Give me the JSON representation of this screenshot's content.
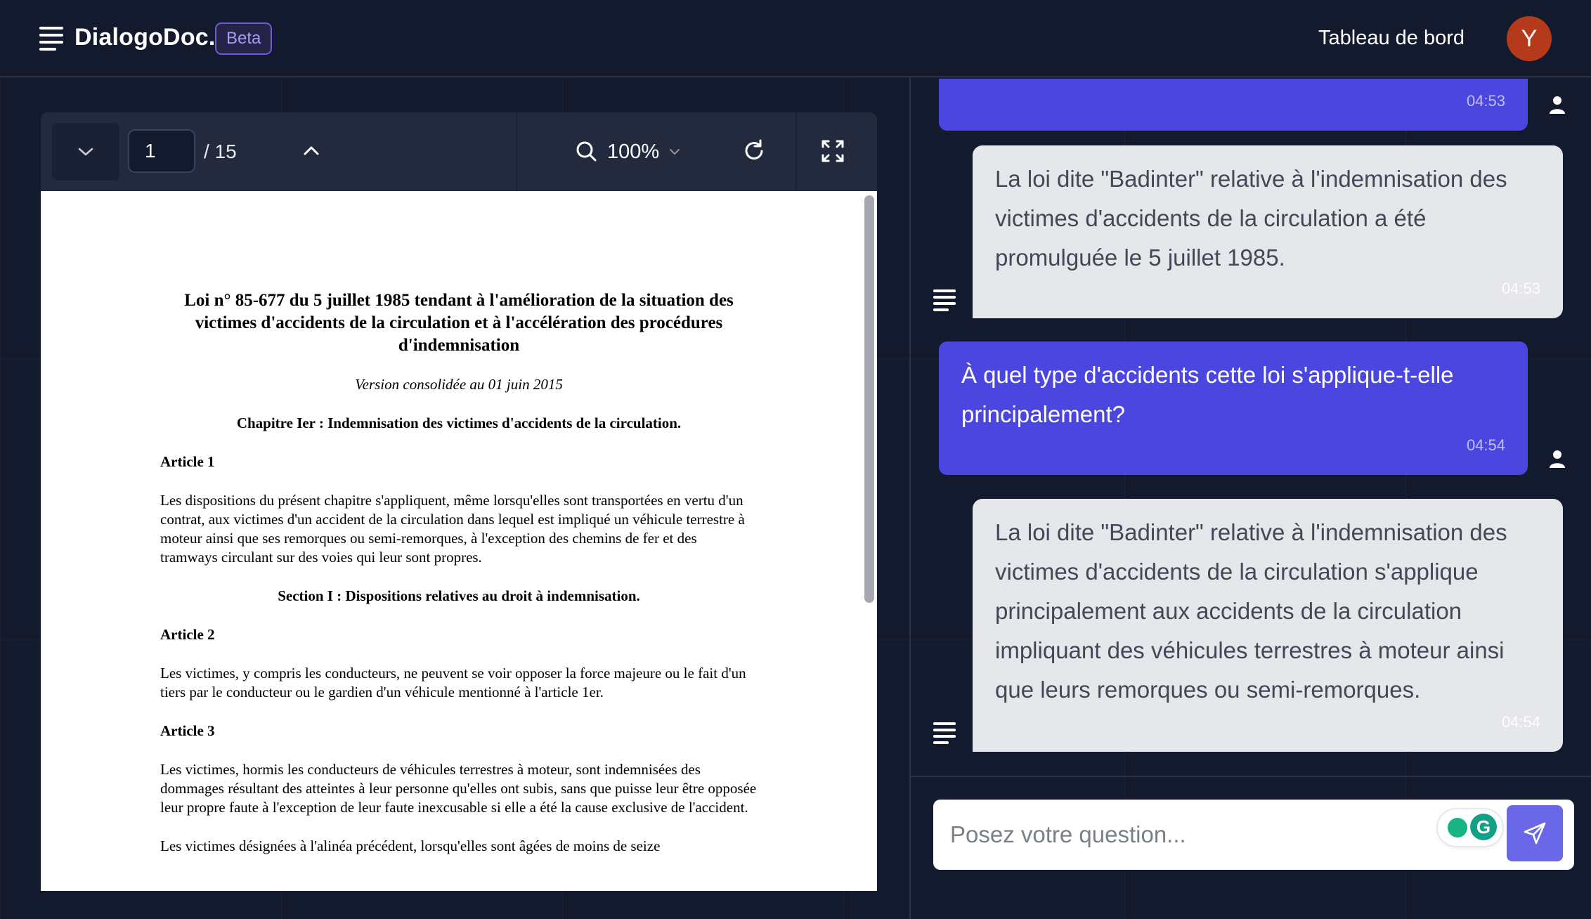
{
  "header": {
    "brand": "DialogoDoc.",
    "badge": "Beta",
    "nav_link": "Tableau de bord",
    "avatar_initial": "Y",
    "avatar_color": "#b53a1c"
  },
  "pdf_toolbar": {
    "current_page": "1",
    "total_pages": "/ 15",
    "zoom": "100%",
    "icons": [
      "chevron-down-icon",
      "chevron-up-icon",
      "search-icon",
      "refresh-icon",
      "fullscreen-icon"
    ]
  },
  "document": {
    "title": "Loi n° 85-677 du 5 juillet 1985 tendant à l'amélioration de la situation des victimes d'accidents de la circulation et à l'accélération des procédures d'indemnisation",
    "version": "Version consolidée au 01 juin 2015",
    "chapter": "Chapitre Ier : Indemnisation des victimes d'accidents de la circulation.",
    "article1_heading": "Article 1",
    "article1_text": "Les dispositions du présent chapitre s'appliquent, même lorsqu'elles sont transportées en vertu d'un contrat, aux victimes d'un accident de la circulation dans lequel est impliqué un véhicule terrestre à moteur ainsi que ses remorques ou semi-remorques, à l'exception des chemins de fer et des tramways circulant sur des voies qui leur sont propres.",
    "section1": "Section I : Dispositions relatives au droit à indemnisation.",
    "article2_heading": "Article 2",
    "article2_text": "Les victimes, y compris les conducteurs, ne peuvent se voir opposer la force majeure ou le fait d'un tiers par le conducteur ou le gardien d'un véhicule mentionné à l'article 1er.",
    "article3_heading": "Article 3",
    "article3_text": "Les victimes, hormis les conducteurs de véhicules terrestres à moteur, sont indemnisées des dommages résultant des atteintes à leur personne qu'elles ont subis, sans que puisse leur être opposée leur propre faute à l'exception de leur faute inexcusable si elle a été la cause exclusive de l'accident.",
    "article3_text2": "Les victimes désignées à l'alinéa précédent, lorsqu'elles sont âgées de moins de seize"
  },
  "chat": {
    "messages": [
      {
        "role": "user",
        "text": "",
        "time": "04:53"
      },
      {
        "role": "assistant",
        "text": "La loi dite \"Badinter\" relative à l'indemnisation des victimes d'accidents de la circulation a été promulguée le 5 juillet 1985.",
        "time": "04:53"
      },
      {
        "role": "user",
        "text": "À quel type d'accidents cette loi s'applique-t-elle principalement?",
        "time": "04:54"
      },
      {
        "role": "assistant",
        "text": "La loi dite \"Badinter\" relative à l'indemnisation des victimes d'accidents de la circulation s'applique principalement aux accidents de la circulation impliquant des véhicules terrestres à moteur ainsi que leurs remorques ou semi-remorques.",
        "time": "04:54"
      }
    ],
    "input_placeholder": "Posez votre question...",
    "extension_letter": "G",
    "accent_color": "#4b46df"
  }
}
